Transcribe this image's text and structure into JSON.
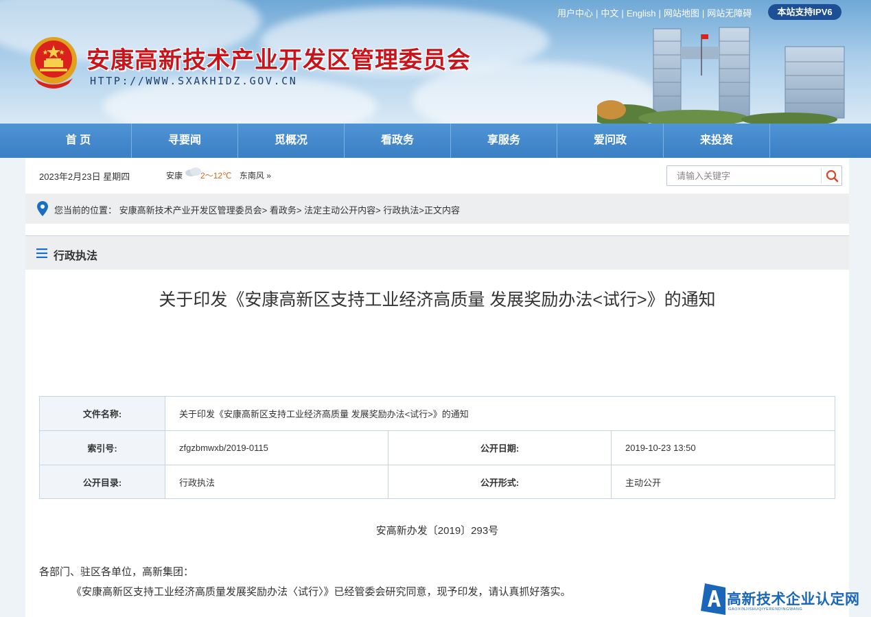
{
  "header": {
    "site_title": "安康高新技术产业开发区管理委员会",
    "site_url": "HTTP://WWW.SXAKHIDZ.GOV.CN",
    "top_links": [
      "用户中心",
      "中文",
      "English",
      "网站地图",
      "网站无障碍"
    ],
    "ipv6_badge": "本站支持IPV6"
  },
  "nav": {
    "items": [
      "首 页",
      "寻要闻",
      "觅概况",
      "看政务",
      "享服务",
      "爱问政",
      "来投资"
    ]
  },
  "info_bar": {
    "date": "2023年2月23日 星期四",
    "city": "安康",
    "temperature": "2～12℃",
    "wind": "东南风",
    "wind_more": "»"
  },
  "search": {
    "placeholder": "请输入关键字"
  },
  "breadcrumb": {
    "label": "您当前的位置：",
    "path": [
      "安康高新技术产业开发区管理委员会",
      "看政务",
      "法定主动公开内容",
      "行政执法",
      "正文内容"
    ]
  },
  "section": {
    "title": "行政执法"
  },
  "article": {
    "title": "关于印发《安康高新区支持工业经济高质量 发展奖励办法<试行>》的通知",
    "doc_number": "安高新办发〔2019〕293号",
    "salutation": "各部门、驻区各单位，高新集团：",
    "paragraph": "《安康高新区支持工业经济高质量发展奖励办法〈试行〉》已经管委会研究同意，现予印发，请认真抓好落实。"
  },
  "info_table": {
    "file_name_label": "文件名称:",
    "file_name": "关于印发《安康高新区支持工业经济高质量 发展奖励办法<试行>》的通知",
    "index_label": "索引号:",
    "index": "zfgzbmwxb/2019-0115",
    "pub_date_label": "公开日期:",
    "pub_date": "2019-10-23 13:50",
    "catalog_label": "公开目录:",
    "catalog": "行政执法",
    "form_label": "公开形式:",
    "form": "主动公开"
  },
  "watermark": {
    "title": "高新技术企业认定网",
    "subtitle": "GAOXINJISHUQIYERENDINGWANG"
  },
  "colors": {
    "nav_blue": "#3b7fc4",
    "title_red": "#c8141a",
    "ipv6_badge": "#1c4f94",
    "search_icon": "#d9452b",
    "pin_blue": "#1a6fc4"
  }
}
